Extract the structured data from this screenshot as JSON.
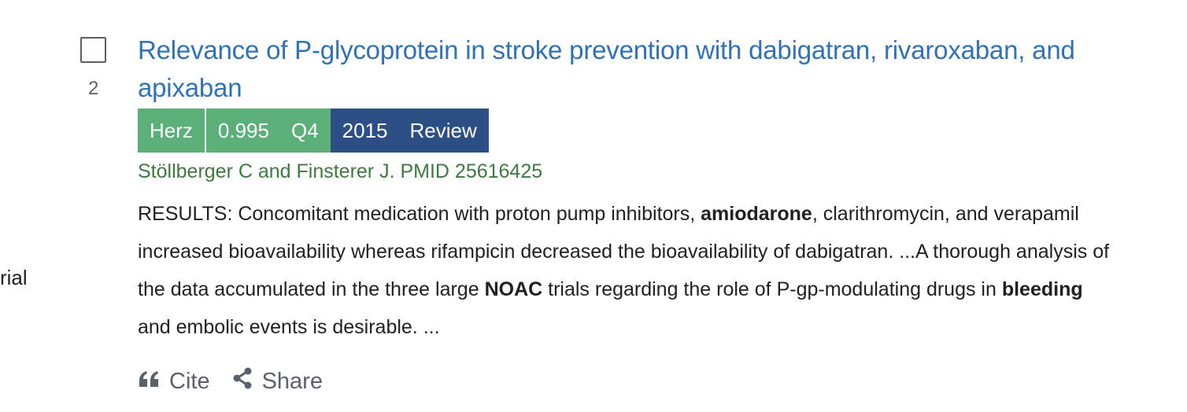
{
  "sidebar_fragment": "rial",
  "result": {
    "number": "2",
    "title": "Relevance of P-glycoprotein in stroke prevention with dabigatran, rivaroxaban, and apixaban",
    "journal": "Herz",
    "impact_factor": "0.995",
    "quartile": "Q4",
    "year": "2015",
    "pub_type": "Review",
    "citation": "Stöllberger C and Finsterer J. PMID 25616425",
    "snippet": {
      "part1": "RESULTS: Concomitant medication with proton pump inhibitors, ",
      "bold1": "amiodarone",
      "part2": ", clarithromycin, and verapamil increased bioavailability whereas rifampicin decreased the bioavailability of dabigatran. ...A thorough analysis of the data accumulated in the three large ",
      "bold2": "NOAC",
      "part3": " trials regarding the role of P-gp-modulating drugs in ",
      "bold3": "bleeding",
      "part4": " and embolic events is desirable. ..."
    }
  },
  "actions": {
    "cite_label": "Cite",
    "share_label": "Share"
  },
  "colors": {
    "title_link": "#2f72b9",
    "badge_green": "#5bb07a",
    "badge_blue": "#2c4f86",
    "citation_green": "#3e7a3f"
  },
  "icons": {
    "cite": "quote-icon",
    "share": "share-icon"
  }
}
